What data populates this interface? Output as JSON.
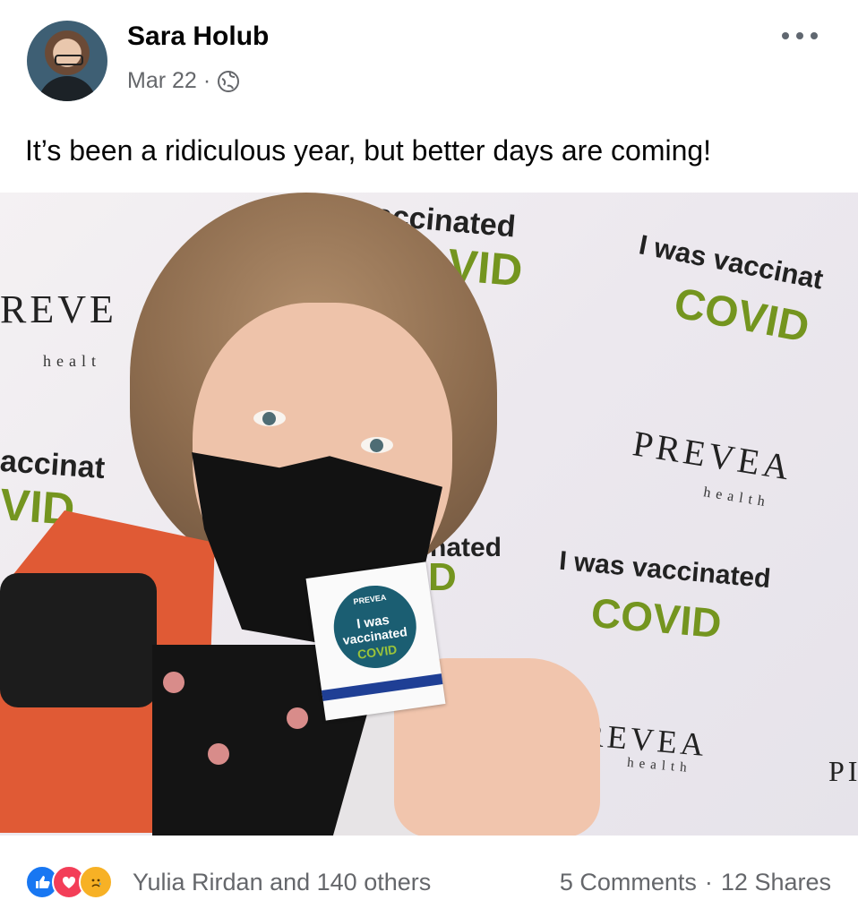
{
  "post": {
    "author": "Sara Holub",
    "date": "Mar 22",
    "meta_separator": "·",
    "privacy_icon": "globe-icon",
    "more_icon": "more-options-icon",
    "text": "It’s been a ridiculous year, but better days are coming!"
  },
  "photo": {
    "backdrop_texts": [
      "vaccinated",
      "VID",
      "I was vaccinat",
      "COVID",
      "REVE",
      "healt",
      "accinat",
      "VID",
      "PREVEA",
      "health",
      "nated",
      "D",
      "I was vaccinated",
      "COVID",
      "REVEA",
      "health",
      "PI"
    ],
    "sticker": {
      "brand": "PREVEA",
      "line1": "I was",
      "line2": "vaccinated",
      "line3": "COVID"
    }
  },
  "footer": {
    "reactions": [
      "like",
      "love",
      "sad"
    ],
    "reactors_text": "Yulia Rirdan and 140 others",
    "comments": "5 Comments",
    "separator": "·",
    "shares": "12 Shares"
  },
  "colors": {
    "like": "#1877f2",
    "love": "#f33e58",
    "sad": "#f7b125",
    "secondary_text": "#65676b",
    "covid_green": "#74951f"
  }
}
